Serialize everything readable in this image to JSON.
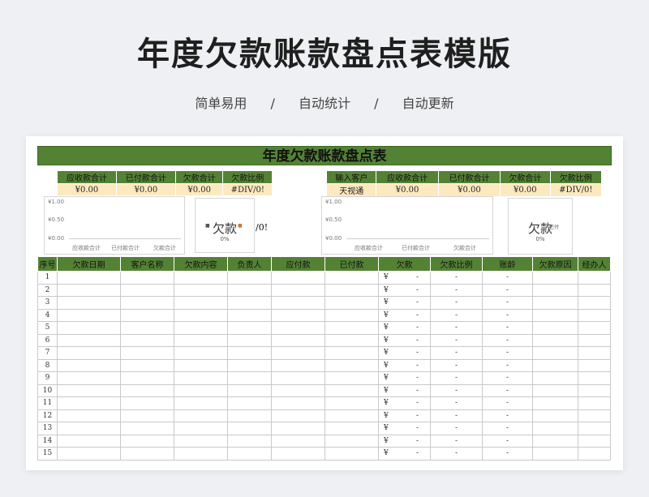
{
  "hero": {
    "title": "年度欠款账款盘点表模版",
    "subtitle": [
      "简单易用",
      "/",
      "自动统计",
      "/",
      "自动更新"
    ]
  },
  "sheet": {
    "title": "年度欠款账款盘点表",
    "summary_left": {
      "headers": [
        "应收款合计",
        "已付款合计",
        "欠款合计",
        "欠款比例"
      ],
      "values": [
        "¥0.00",
        "¥0.00",
        "¥0.00",
        "#DIV/0!"
      ]
    },
    "summary_right": {
      "headers": [
        "输入客户",
        "应收款合计",
        "已付款合计",
        "欠款合计",
        "欠款比例"
      ],
      "values": [
        "天视通",
        "¥0.00",
        "¥0.00",
        "¥0.00",
        "#DIV/0!"
      ]
    },
    "bar_chart": {
      "y_ticks": [
        "¥1.00",
        "¥0.50",
        "¥0.00"
      ],
      "categories": [
        "应收款合计",
        "已付款合计",
        "欠款合计"
      ]
    },
    "pie_chart": {
      "title": "欠款",
      "percent": "0%",
      "legend": [
        "欠款",
        "已付"
      ],
      "overflow_text": "/0!"
    },
    "table": {
      "headers": [
        "序号",
        "欠款日期",
        "客户名称",
        "欠款内容",
        "负责人",
        "应付款",
        "已付款",
        "欠款",
        "欠款比例",
        "账龄",
        "欠款原因",
        "经办人"
      ],
      "currency_symbol": "¥",
      "dash": "-",
      "rows": [
        "1",
        "2",
        "3",
        "4",
        "5",
        "6",
        "7",
        "8",
        "9",
        "10",
        "11",
        "12",
        "13",
        "14",
        "15"
      ]
    }
  },
  "colors": {
    "header_green": "#548235",
    "summary_fill": "#fde9c0"
  }
}
